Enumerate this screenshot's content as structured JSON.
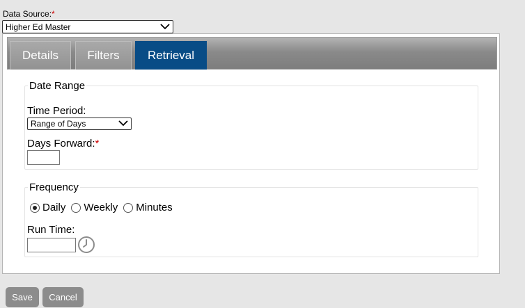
{
  "data_source": {
    "label": "Data Source:",
    "required_mark": "*",
    "selected": "Higher Ed Master"
  },
  "tabs": [
    {
      "label": "Details",
      "active": false
    },
    {
      "label": "Filters",
      "active": false
    },
    {
      "label": "Retrieval",
      "active": true
    }
  ],
  "date_range": {
    "legend": "Date Range",
    "time_period_label": "Time Period:",
    "time_period_selected": "Range of Days",
    "days_forward_label": "Days Forward:",
    "days_forward_required_mark": "*",
    "days_forward_value": ""
  },
  "frequency": {
    "legend": "Frequency",
    "options": [
      {
        "label": "Daily",
        "checked": true
      },
      {
        "label": "Weekly",
        "checked": false
      },
      {
        "label": "Minutes",
        "checked": false
      }
    ],
    "run_time_label": "Run Time:",
    "run_time_value": ""
  },
  "buttons": {
    "save": "Save",
    "cancel": "Cancel"
  },
  "icons": {
    "dropdown": "chevron-down-icon",
    "time_picker": "clock-icon"
  }
}
